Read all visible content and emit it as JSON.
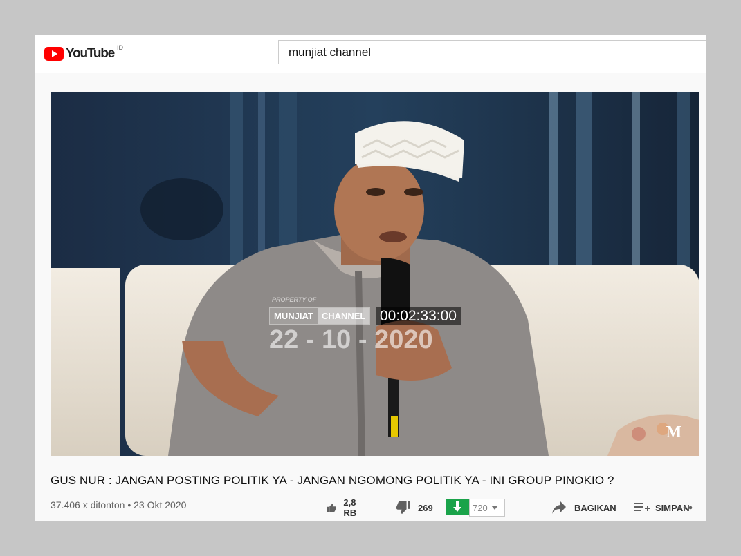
{
  "header": {
    "logo_text": "YouTube",
    "region": "ID",
    "search_value": "munjiat channel"
  },
  "video": {
    "watermark_property": "PROPERTY OF",
    "watermark_name_1": "MUNJIAT",
    "watermark_name_2": "CHANNEL",
    "watermark_time": "00:02:33:00",
    "watermark_date": "22 - 10 - 2020",
    "corner_logo": "M",
    "title": "GUS NUR : JANGAN POSTING POLITIK YA - JANGAN NGOMONG POLITIK YA - INI GROUP PINOKIO ?",
    "views": "37.406 x ditonton",
    "separator": "•",
    "date": "23 Okt 2020"
  },
  "actions": {
    "likes": "2,8 RB",
    "dislikes": "269",
    "download_count": "720",
    "share_label": "BAGIKAN",
    "save_label": "SIMPAN"
  },
  "colors": {
    "youtube_red": "#ff0000",
    "download_green": "#1aa34a",
    "text_primary": "#0f0f0f",
    "text_secondary": "#606060"
  }
}
